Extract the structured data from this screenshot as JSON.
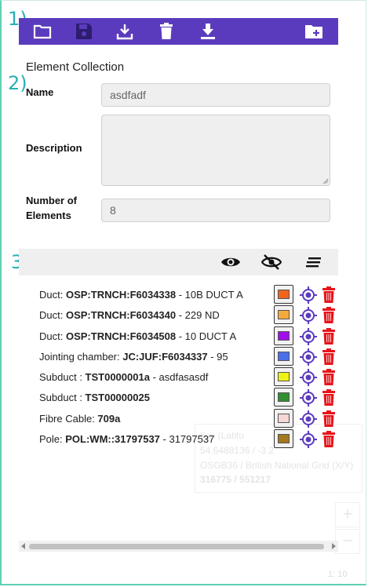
{
  "markers": [
    "1)",
    "2)",
    "3)"
  ],
  "toolbar": {
    "buttons": [
      {
        "name": "open-folder-icon"
      },
      {
        "name": "save-icon"
      },
      {
        "name": "download-tray-icon"
      },
      {
        "name": "delete-icon"
      },
      {
        "name": "download-icon"
      },
      {
        "name": "add-folder-icon"
      }
    ]
  },
  "collection": {
    "title": "Element Collection",
    "name_label": "Name",
    "name_value": "asdfadf",
    "description_label": "Description",
    "description_value": "",
    "count_label_line1": "Number of",
    "count_label_line2": "Elements",
    "count_value": "8"
  },
  "panel_icons": [
    "eye-icon",
    "eye-off-icon",
    "sort-lines-icon"
  ],
  "elements": [
    {
      "type": "Duct: ",
      "id": "OSP:TRNCH:F6034338",
      "desc": " - 10B DUCT A",
      "color": "#f0641e"
    },
    {
      "type": "Duct: ",
      "id": "OSP:TRNCH:F6034340",
      "desc": " - 229 ND",
      "color": "#f5a93c"
    },
    {
      "type": "Duct: ",
      "id": "OSP:TRNCH:F6034508",
      "desc": " - 10 DUCT A",
      "color": "#a10fe8"
    },
    {
      "type": "Jointing chamber: ",
      "id": "JC:JUF:F6034337",
      "desc": " - 95",
      "color": "#4b6fe8"
    },
    {
      "type": "Subduct : ",
      "id": "TST0000001a",
      "desc": " - asdfasasdf",
      "color": "#eef214"
    },
    {
      "type": "Subduct : ",
      "id": "TST00000025",
      "desc": "",
      "color": "#2f8f2f"
    },
    {
      "type": "Fibre Cable: ",
      "id": "709a",
      "desc": "",
      "color": "#f7d6d6"
    },
    {
      "type": "Pole: ",
      "id": "POL:WM::31797537",
      "desc": " - 31797537",
      "color": "#a3781e"
    }
  ],
  "background_map": {
    "line1": "tion (Latitu",
    "line2": "54.6488136 / -3.2",
    "line3": "OSGB36 / British National Grid (X/Y)",
    "line4": "316775 / 551217",
    "zoom_in": "+",
    "zoom_out": "−",
    "scale": "1: 10"
  },
  "colors": {
    "toolbar": "#5b3bbd",
    "accent": "#5b3bbd",
    "marker": "#26b0b4",
    "trash": "#e8141b"
  }
}
